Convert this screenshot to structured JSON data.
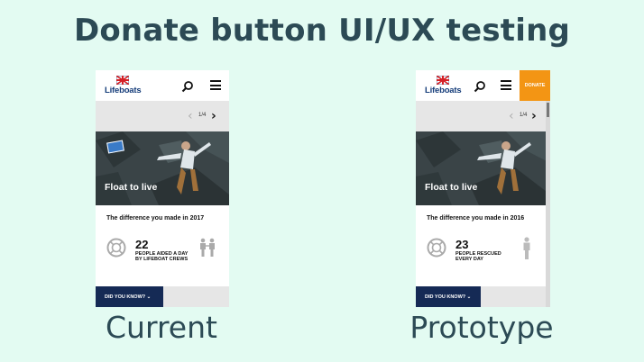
{
  "title": "Donate button UI/UX testing",
  "panels": {
    "current": {
      "caption": "Current",
      "logo_text": "Lifeboats",
      "pager": "1/4",
      "hero_title": "Float to live",
      "difference_title": "The difference you made in 2017",
      "stat_number": "22",
      "stat_description": "PEOPLE AIDED A DAY BY LIFEBOAT CREWS",
      "did_you_know": "DID YOU KNOW? ⌄",
      "icons": [
        "search-icon",
        "menu-icon",
        "lifebuoy-icon",
        "two-people-icon"
      ]
    },
    "prototype": {
      "caption": "Prototype",
      "logo_text": "Lifeboats",
      "pager": "1/4",
      "donate_label": "DONATE",
      "hero_title": "Float to live",
      "difference_title": "The difference you made in 2016",
      "stat_number": "23",
      "stat_description": "PEOPLE RESCUED EVERY DAY",
      "did_you_know": "DID YOU KNOW? ⌄",
      "icons": [
        "search-icon",
        "menu-icon",
        "lifebuoy-icon",
        "person-icon"
      ]
    }
  },
  "colors": {
    "background": "#e3fbf2",
    "heading": "#2c4a55",
    "donate": "#f39514",
    "navy": "#152a55"
  }
}
